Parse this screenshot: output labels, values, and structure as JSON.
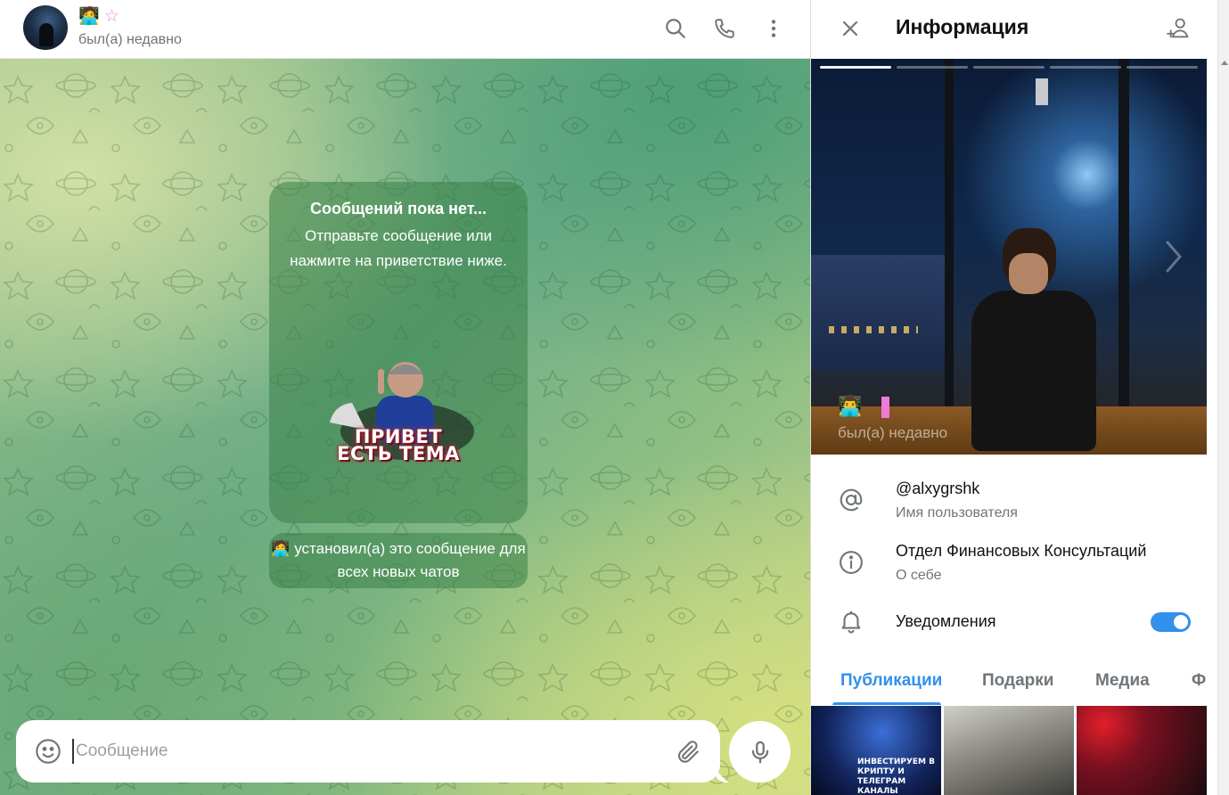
{
  "chat": {
    "name_emoji": "🧑‍💻",
    "name_star": "☆",
    "status": "был(а) недавно",
    "greeting": {
      "title": "Сообщений пока нет...",
      "text": "Отправьте сообщение или нажмите на приветствие ниже.",
      "sticker_line1": "ПРИВЕТ",
      "sticker_line2": "ЕСТЬ ТЕМА"
    },
    "service_message": "🧑‍💻 установил(а) это сообщение для всех новых чатов",
    "composer": {
      "placeholder": "Сообщение",
      "value": ""
    }
  },
  "info": {
    "title": "Информация",
    "photo_status": "был(а) недавно",
    "photo_emoji": "👨‍💻",
    "username": "@alxygrshk",
    "username_label": "Имя пользователя",
    "bio": "Отдел Финансовых Консультаций",
    "bio_label": "О себе",
    "notifications_label": "Уведомления",
    "notifications_on": true,
    "tabs": [
      {
        "label": "Публикации",
        "active": true
      },
      {
        "label": "Подарки",
        "active": false
      },
      {
        "label": "Медиа",
        "active": false
      },
      {
        "label": "Ф",
        "active": false
      }
    ],
    "media": [
      {
        "caption": "ИНВЕСТИРУЕМ В КРИПТУ И ТЕЛЕГРАМ КАНАЛЫ"
      }
    ]
  },
  "colors": {
    "accent": "#3390ec",
    "secondary_text": "#707579",
    "bubble": "rgba(58,130,72,0.55)"
  },
  "icons": {
    "header": [
      "search-icon",
      "phone-icon",
      "more-vertical-icon"
    ],
    "info_header": [
      "close-icon",
      "add-contact-icon"
    ],
    "rows": [
      "at-sign-icon",
      "info-icon",
      "bell-icon"
    ],
    "composer": [
      "emoji-icon",
      "attach-icon",
      "microphone-icon"
    ]
  }
}
